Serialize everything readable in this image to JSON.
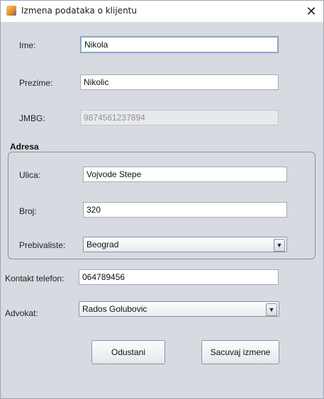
{
  "window": {
    "title": "Izmena podataka o klijentu",
    "close_glyph": "✕"
  },
  "form": {
    "ime": {
      "label": "Ime:",
      "value": "Nikola"
    },
    "prezime": {
      "label": "Prezime:",
      "value": "Nikolic"
    },
    "jmbg": {
      "label": "JMBG:",
      "value": "9874561237894"
    }
  },
  "adresa": {
    "title": "Adresa",
    "ulica": {
      "label": "Ulica:",
      "value": "Vojvode Stepe"
    },
    "broj": {
      "label": "Broj:",
      "value": "320"
    },
    "prebivaliste": {
      "label": "Prebivaliste:",
      "selected": "Beograd"
    }
  },
  "kontakt": {
    "label": "Kontakt telefon:",
    "value": "064789456"
  },
  "advokat": {
    "label": "Advokat:",
    "selected": "Rados Golubovic"
  },
  "buttons": {
    "cancel": "Odustani",
    "save": "Sacuvaj izmene"
  },
  "icons": {
    "combo_arrow": "▼"
  }
}
